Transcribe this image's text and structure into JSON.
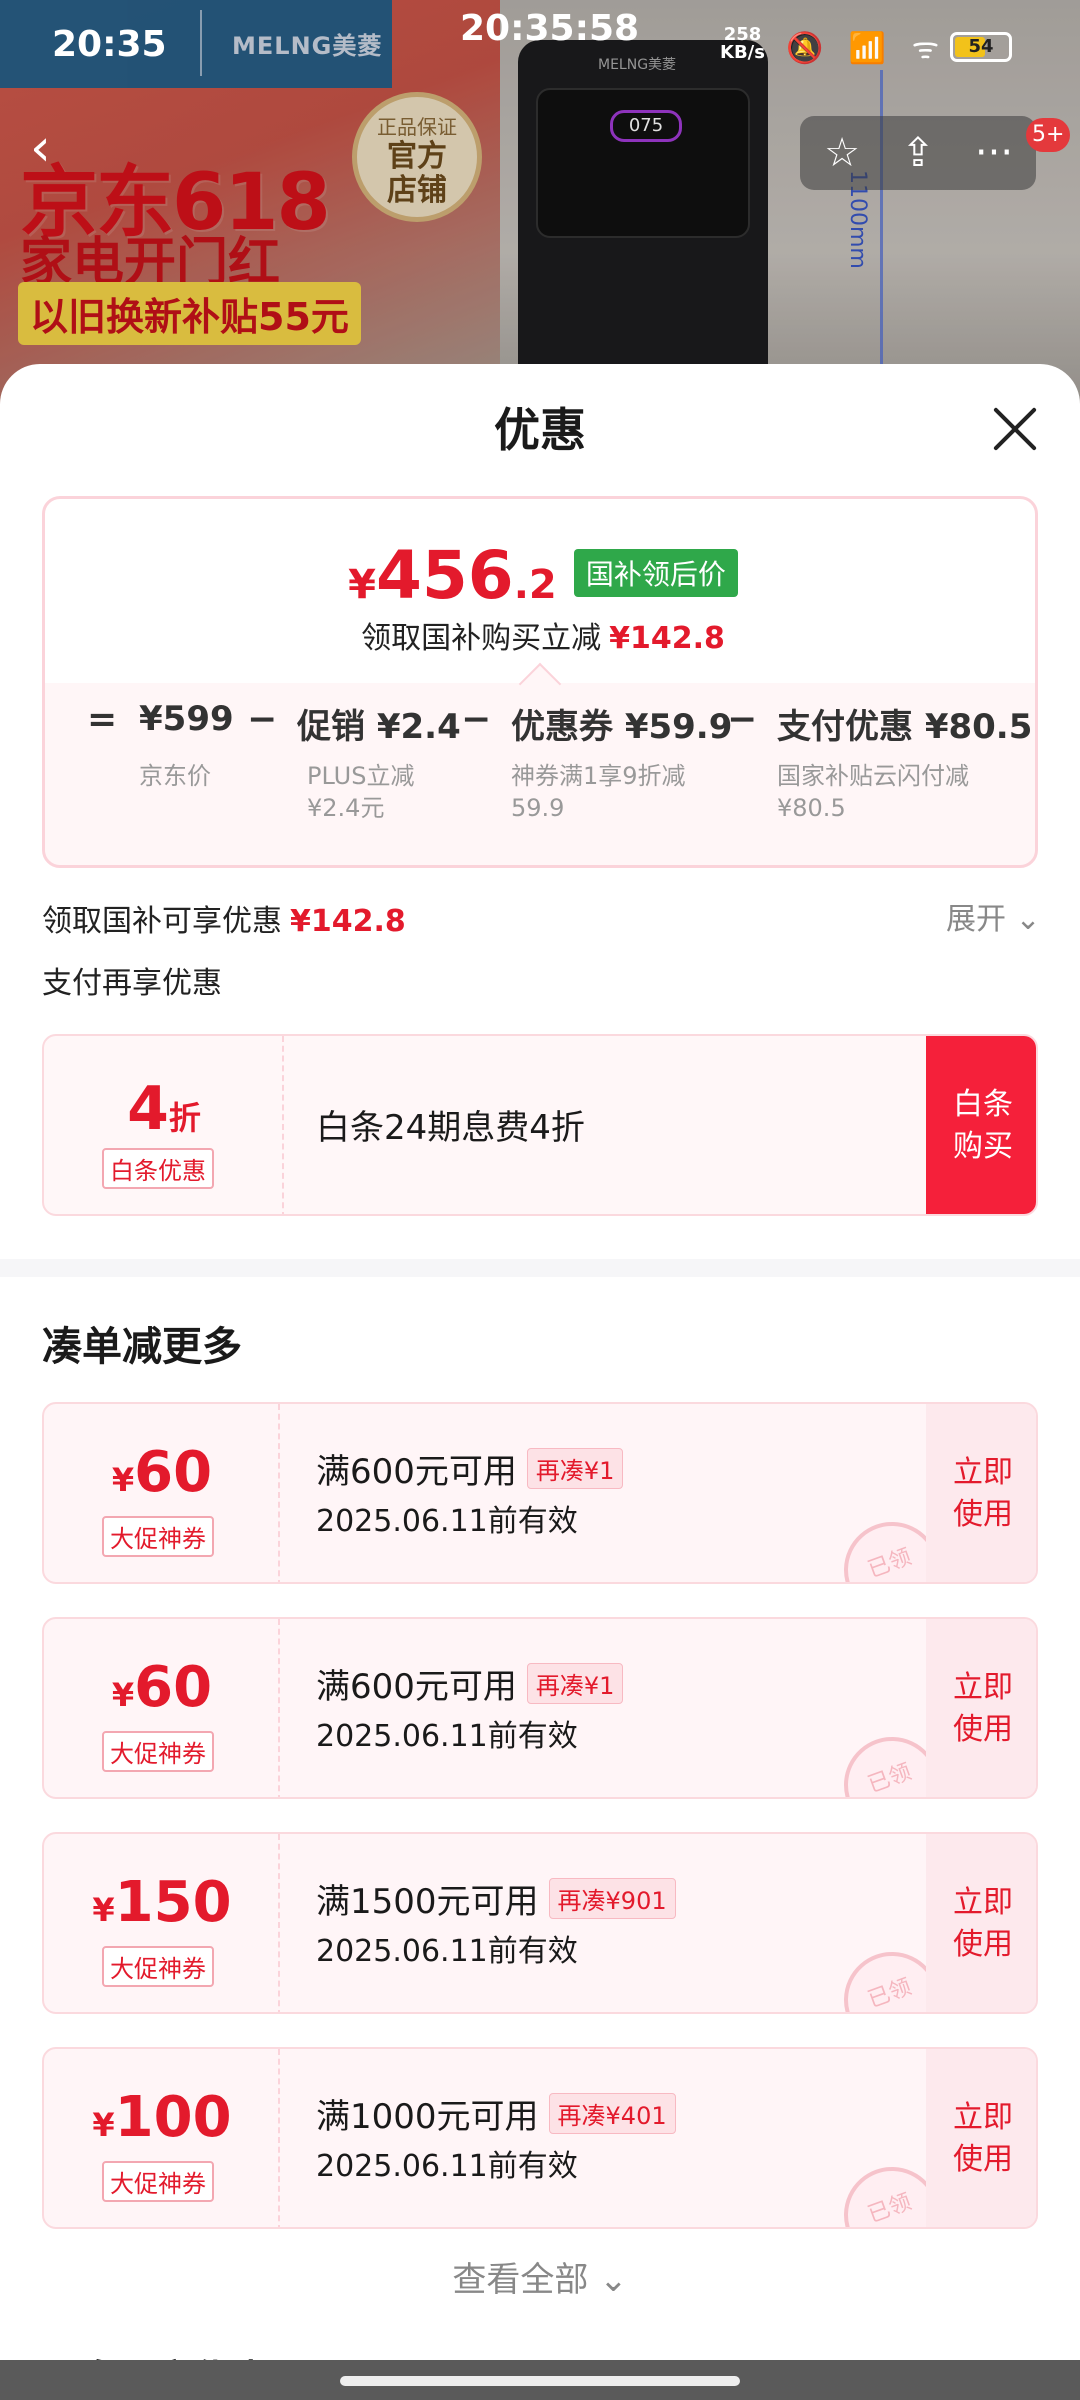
{
  "status_bar": {
    "time": "20:35",
    "clock": "20:35:58",
    "net_speed": "258",
    "net_unit": "KB/s",
    "icons": "🔕 📶 ᯤ",
    "battery": "54"
  },
  "background": {
    "logo": "MELNG美菱",
    "promo_title": "京东618",
    "promo_sub": "家电开门红",
    "promo_strip": "以旧换新补贴55元",
    "badge_top": "正品保证",
    "badge_main_1": "官方",
    "badge_main_2": "店铺",
    "device_brand": "MELNG美菱",
    "device_display": "075",
    "measure": "1100mm"
  },
  "top_actions": {
    "back": "‹",
    "favorite": "☆",
    "share": "⇪",
    "more": "···",
    "badge": "5+"
  },
  "sheet": {
    "title": "优惠",
    "final_price": {
      "yen": "¥",
      "integer": "456",
      "decimal": ".2",
      "tag": "国补领后价"
    },
    "savings_text": "领取国补购买立减",
    "savings_value": "¥142.8",
    "breakdown": {
      "eq": "=",
      "base_value": "¥599",
      "base_note": "京东价",
      "op1": "−",
      "promo_value": "促销 ¥2.4",
      "promo_note_1": "PLUS立减",
      "promo_note_2": "¥2.4元",
      "op2": "−",
      "coupon_value": "优惠券 ¥59.9",
      "coupon_note_1": "神券满1享9折减",
      "coupon_note_2": "59.9",
      "op3": "−",
      "pay_value": "支付优惠 ¥80.5",
      "pay_note_1": "国家补贴云闪付减",
      "pay_note_2": "¥80.5"
    },
    "subsidy_label": "领取国补可享优惠",
    "subsidy_value": "¥142.8",
    "expand_label": "展开 ⌄",
    "pay_more_label": "支付再享优惠",
    "baitiao": {
      "num": "4",
      "unit": "折",
      "chip": "白条优惠",
      "text": "白条24期息费4折",
      "buy_1": "白条",
      "buy_2": "购买"
    },
    "section_title": "凑单减更多",
    "coupons": [
      {
        "yen": "¥",
        "amount": "60",
        "chip": "大促神券",
        "condition": "满600元可用",
        "add": "再凑¥1",
        "validity": "2025.06.11前有效",
        "use_1": "立即",
        "use_2": "使用",
        "stamp": "已领"
      },
      {
        "yen": "¥",
        "amount": "60",
        "chip": "大促神券",
        "condition": "满600元可用",
        "add": "再凑¥1",
        "validity": "2025.06.11前有效",
        "use_1": "立即",
        "use_2": "使用",
        "stamp": "已领"
      },
      {
        "yen": "¥",
        "amount": "150",
        "chip": "大促神券",
        "condition": "满1500元可用",
        "add": "再凑¥901",
        "validity": "2025.06.11前有效",
        "use_1": "立即",
        "use_2": "使用",
        "stamp": "已领"
      },
      {
        "yen": "¥",
        "amount": "100",
        "chip": "大促神券",
        "condition": "满1000元可用",
        "add": "再凑¥401",
        "validity": "2025.06.11前有效",
        "use_1": "立即",
        "use_2": "使用",
        "stamp": "已领"
      }
    ],
    "see_all": "查看全部 ⌄",
    "bottom_peek": "更多更实优惠"
  }
}
